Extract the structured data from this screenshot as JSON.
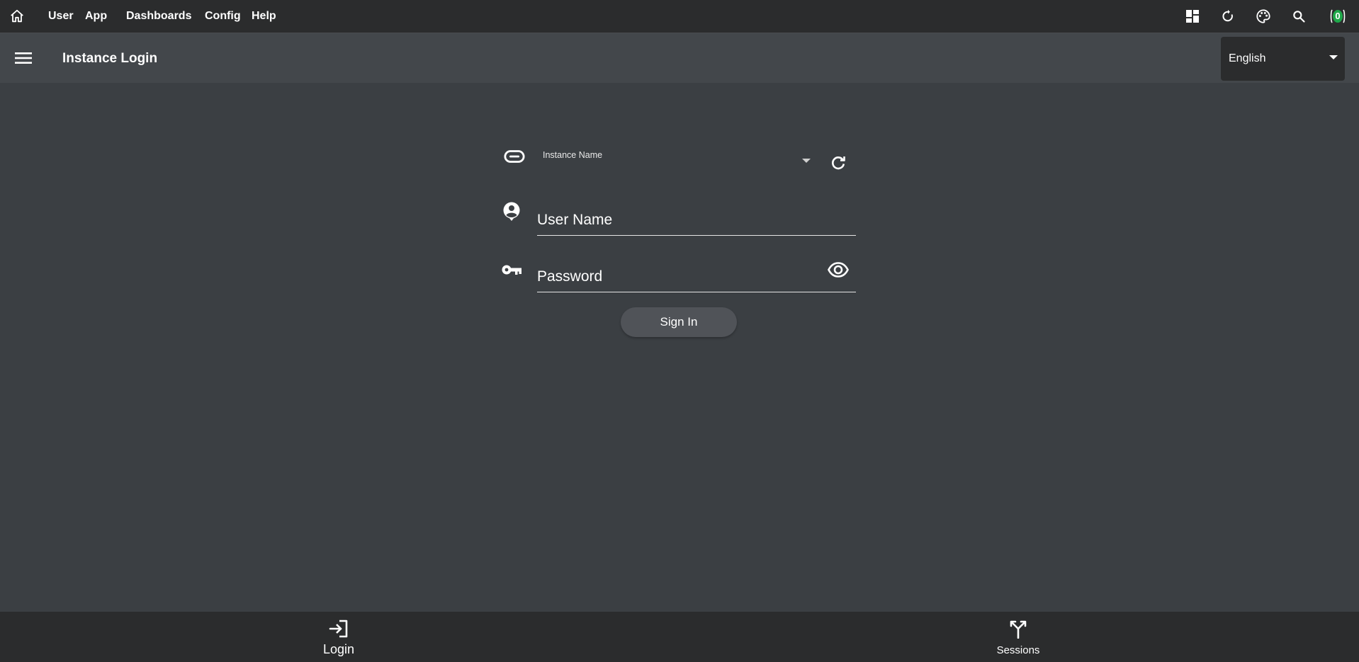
{
  "menubar": {
    "items": [
      {
        "label": "User"
      },
      {
        "label": "App"
      },
      {
        "label": "Dashboards"
      },
      {
        "label": "Config"
      },
      {
        "label": "Help"
      }
    ],
    "badge_count": "0"
  },
  "header": {
    "title": "Instance Login",
    "language": "English"
  },
  "form": {
    "instance_label": "Instance Name",
    "instance_value": "",
    "username_placeholder": "User Name",
    "username_value": "",
    "password_placeholder": "Password",
    "password_value": "",
    "signin_label": "Sign In"
  },
  "bottomnav": {
    "login_label": "Login",
    "sessions_label": "Sessions"
  },
  "colors": {
    "background": "#3b3f43",
    "menubar": "#2b2c2d",
    "subheader": "#43474b",
    "badge_green": "#1fa84a"
  },
  "icons": {
    "home": "home-icon",
    "dashboard": "dashboard-icon",
    "refresh": "refresh-icon",
    "palette": "palette-icon",
    "search": "search-icon",
    "status": "status-badge-icon",
    "menu": "hamburger-icon",
    "link": "link-icon",
    "user": "account-icon",
    "key": "key-icon",
    "eye": "eye-icon",
    "login": "login-icon",
    "sessions": "sessions-icon"
  }
}
